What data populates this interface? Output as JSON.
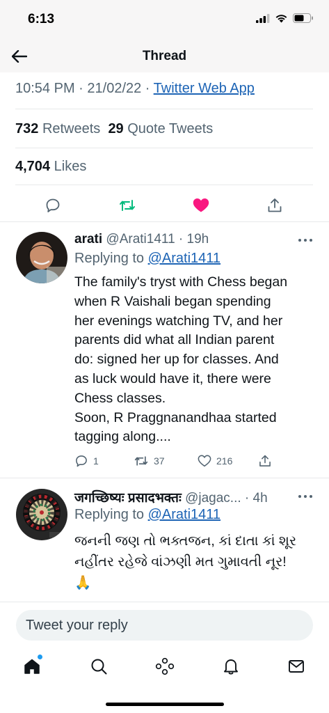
{
  "status_bar": {
    "time": "6:13"
  },
  "header": {
    "title": "Thread"
  },
  "main_tweet": {
    "time": "10:54 PM",
    "separator1": " · ",
    "date": "21/02/22",
    "separator2": " · ",
    "source": "Twitter Web App",
    "retweets_count": "732",
    "retweets_label": "Retweets",
    "quote_count": "29",
    "quote_label": "Quote Tweets",
    "likes_count": "4,704",
    "likes_label": "Likes",
    "actions": [
      "reply-icon",
      "retweet-icon",
      "like-icon",
      "share-icon"
    ],
    "like_color": "#f91880",
    "retweet_color": "#00ba7c"
  },
  "replies": [
    {
      "name": "arati",
      "handle": "@Arati1411",
      "age": "· 19h",
      "replying_prefix": "Replying to",
      "replying_to": "@Arati1411",
      "text": "The family's tryst with Chess began\nwhen R Vaishali began spending\nher evenings watching TV, and her\nparents did what all Indian parent\ndo: signed her up for classes. And\nas luck would have it, there were\nChess classes.\nSoon, R Praggnanandhaa started\ntagging along....",
      "reply_count": "1",
      "retweet_count": "37",
      "like_count": "216"
    },
    {
      "name": "जगच्छिष्यः प्रसादभक्तः",
      "handle": "@jagac...",
      "age": "· 4h",
      "replying_prefix": "Replying to",
      "replying_to": "@Arati1411",
      "text": "જનની જણ તો ભક્તજન, કાં દાતા કાં શૂર\nનહીંતર રહેજે વાંઝણી મત ગુમાવતી નૂર!\n🙏"
    }
  ],
  "reply_box": {
    "placeholder": "Tweet your reply"
  },
  "bottom_nav": [
    "home-icon",
    "search-icon",
    "spaces-icon",
    "notifications-icon",
    "messages-icon"
  ],
  "colors": {
    "accent": "#1d9bf0",
    "link": "#1d64b5",
    "muted": "#536471"
  }
}
